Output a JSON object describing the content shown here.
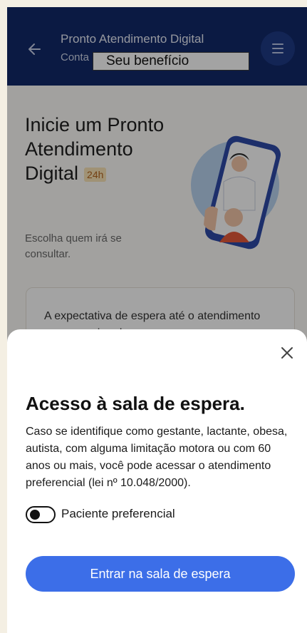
{
  "header": {
    "title": "Pronto Atendimento Digital",
    "subtitle": "Conta",
    "chip_label": "Seu benefício"
  },
  "hero": {
    "title": "Inicie um Pronto Atendimento Digital",
    "badge": "24h",
    "subtitle": "Escolha quem irá se consultar."
  },
  "info_card": {
    "text": "A expectativa de espera até o atendimento com a equipe de"
  },
  "sheet": {
    "title": "Acesso à sala de espera.",
    "description": "Caso se identifique como gestante, lactante, obesa, autista, com alguma limitação motora ou com 60 anos ou mais, você pode acessar o atendimento preferencial (lei nº 10.048/2000).",
    "toggle_label": "Paciente preferencial",
    "toggle_on": false,
    "cta_label": "Entrar na sala de espera"
  },
  "colors": {
    "header_bg": "#12296a",
    "accent": "#3c6ee8",
    "page_bg": "#f4efe3",
    "badge_bg": "#fbe4b7",
    "badge_text": "#b5651d"
  },
  "icons": {
    "back": "arrow-left-icon",
    "menu": "menu-icon",
    "close": "close-icon"
  }
}
